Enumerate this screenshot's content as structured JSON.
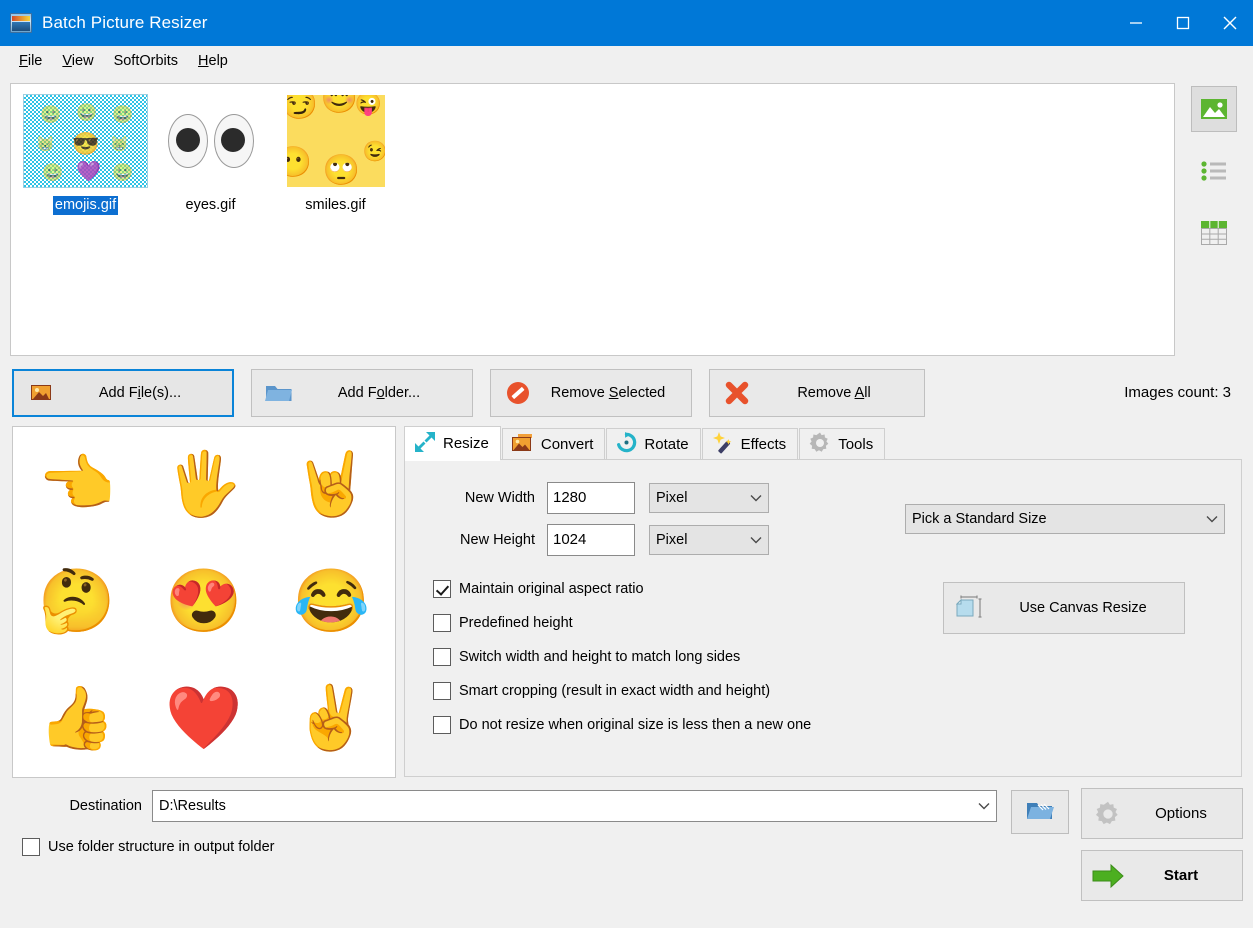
{
  "window": {
    "title": "Batch Picture Resizer",
    "icon": "picture-icon",
    "controls": {
      "minimize": "–",
      "maximize": "□",
      "close": "✕"
    },
    "titlebar_color": "#0078d7"
  },
  "menu": {
    "items": [
      {
        "label": "File",
        "accel": "F"
      },
      {
        "label": "View",
        "accel": "V"
      },
      {
        "label": "SoftOrbits",
        "accel": ""
      },
      {
        "label": "Help",
        "accel": "H"
      }
    ]
  },
  "file_list": {
    "files": [
      {
        "name": "emojis.gif",
        "selected": true,
        "thumb": "checkerboard-emojis"
      },
      {
        "name": "eyes.gif",
        "selected": false,
        "thumb": "googly-eyes"
      },
      {
        "name": "smiles.gif",
        "selected": false,
        "thumb": "yellow-smiles"
      }
    ],
    "view_buttons": [
      {
        "name": "thumbnail-view",
        "active": true
      },
      {
        "name": "list-view",
        "active": false
      },
      {
        "name": "details-view",
        "active": false
      }
    ]
  },
  "actions": {
    "add_files": {
      "label_pre": "Add F",
      "label_accel": "i",
      "label_post": "le(s)...",
      "icon": "add-picture-icon",
      "focused": true
    },
    "add_folder": {
      "label_pre": "Add F",
      "label_accel": "o",
      "label_post": "lder...",
      "icon": "folder-icon"
    },
    "remove_selected": {
      "label_pre": "Remove ",
      "label_accel": "S",
      "label_post": "elected",
      "icon": "no-entry-icon"
    },
    "remove_all": {
      "label_pre": "Remove ",
      "label_accel": "A",
      "label_post": "ll",
      "icon": "red-x-icon"
    },
    "images_count": "Images count: 3"
  },
  "preview": {
    "emojis": [
      "👈",
      "🖐",
      "🤘",
      "🤔",
      "😍",
      "😂",
      "👍",
      "❤️",
      "✌️"
    ]
  },
  "tabs": [
    {
      "label": "Resize",
      "icon": "resize-arrows-icon",
      "active": true
    },
    {
      "label": "Convert",
      "icon": "convert-picture-icon",
      "active": false
    },
    {
      "label": "Rotate",
      "icon": "rotate-icon",
      "active": false
    },
    {
      "label": "Effects",
      "icon": "magic-wand-icon",
      "active": false
    },
    {
      "label": "Tools",
      "icon": "gear-icon",
      "active": false
    }
  ],
  "resize": {
    "new_width": {
      "label": "New Width",
      "value": "1280",
      "unit": "Pixel"
    },
    "new_height": {
      "label": "New Height",
      "value": "1024",
      "unit": "Pixel"
    },
    "standard_size": {
      "value": "Pick a Standard Size"
    },
    "canvas_resize": {
      "label": "Use Canvas Resize",
      "icon": "canvas-resize-icon"
    },
    "checkboxes": [
      {
        "label": "Maintain original aspect ratio",
        "checked": true
      },
      {
        "label": "Predefined height",
        "checked": false
      },
      {
        "label": "Switch width and height to match long sides",
        "checked": false
      },
      {
        "label": "Smart cropping (result in exact width and height)",
        "checked": false
      },
      {
        "label": "Do not resize when original size is less then a new one",
        "checked": false
      }
    ]
  },
  "destination": {
    "label": "Destination",
    "value": "D:\\Results",
    "browse_icon": "open-folder-icon",
    "folder_structure": {
      "label": "Use folder structure in output folder",
      "checked": false
    }
  },
  "footer": {
    "options": {
      "label": "Options",
      "icon": "gear-icon"
    },
    "start": {
      "label": "Start",
      "icon": "green-arrow-icon"
    }
  },
  "colors": {
    "accent": "#0078d7",
    "selection": "#0d6fd1",
    "start_green": "#4caf20",
    "teal": "#25b3c9",
    "orange": "#e8622b"
  }
}
